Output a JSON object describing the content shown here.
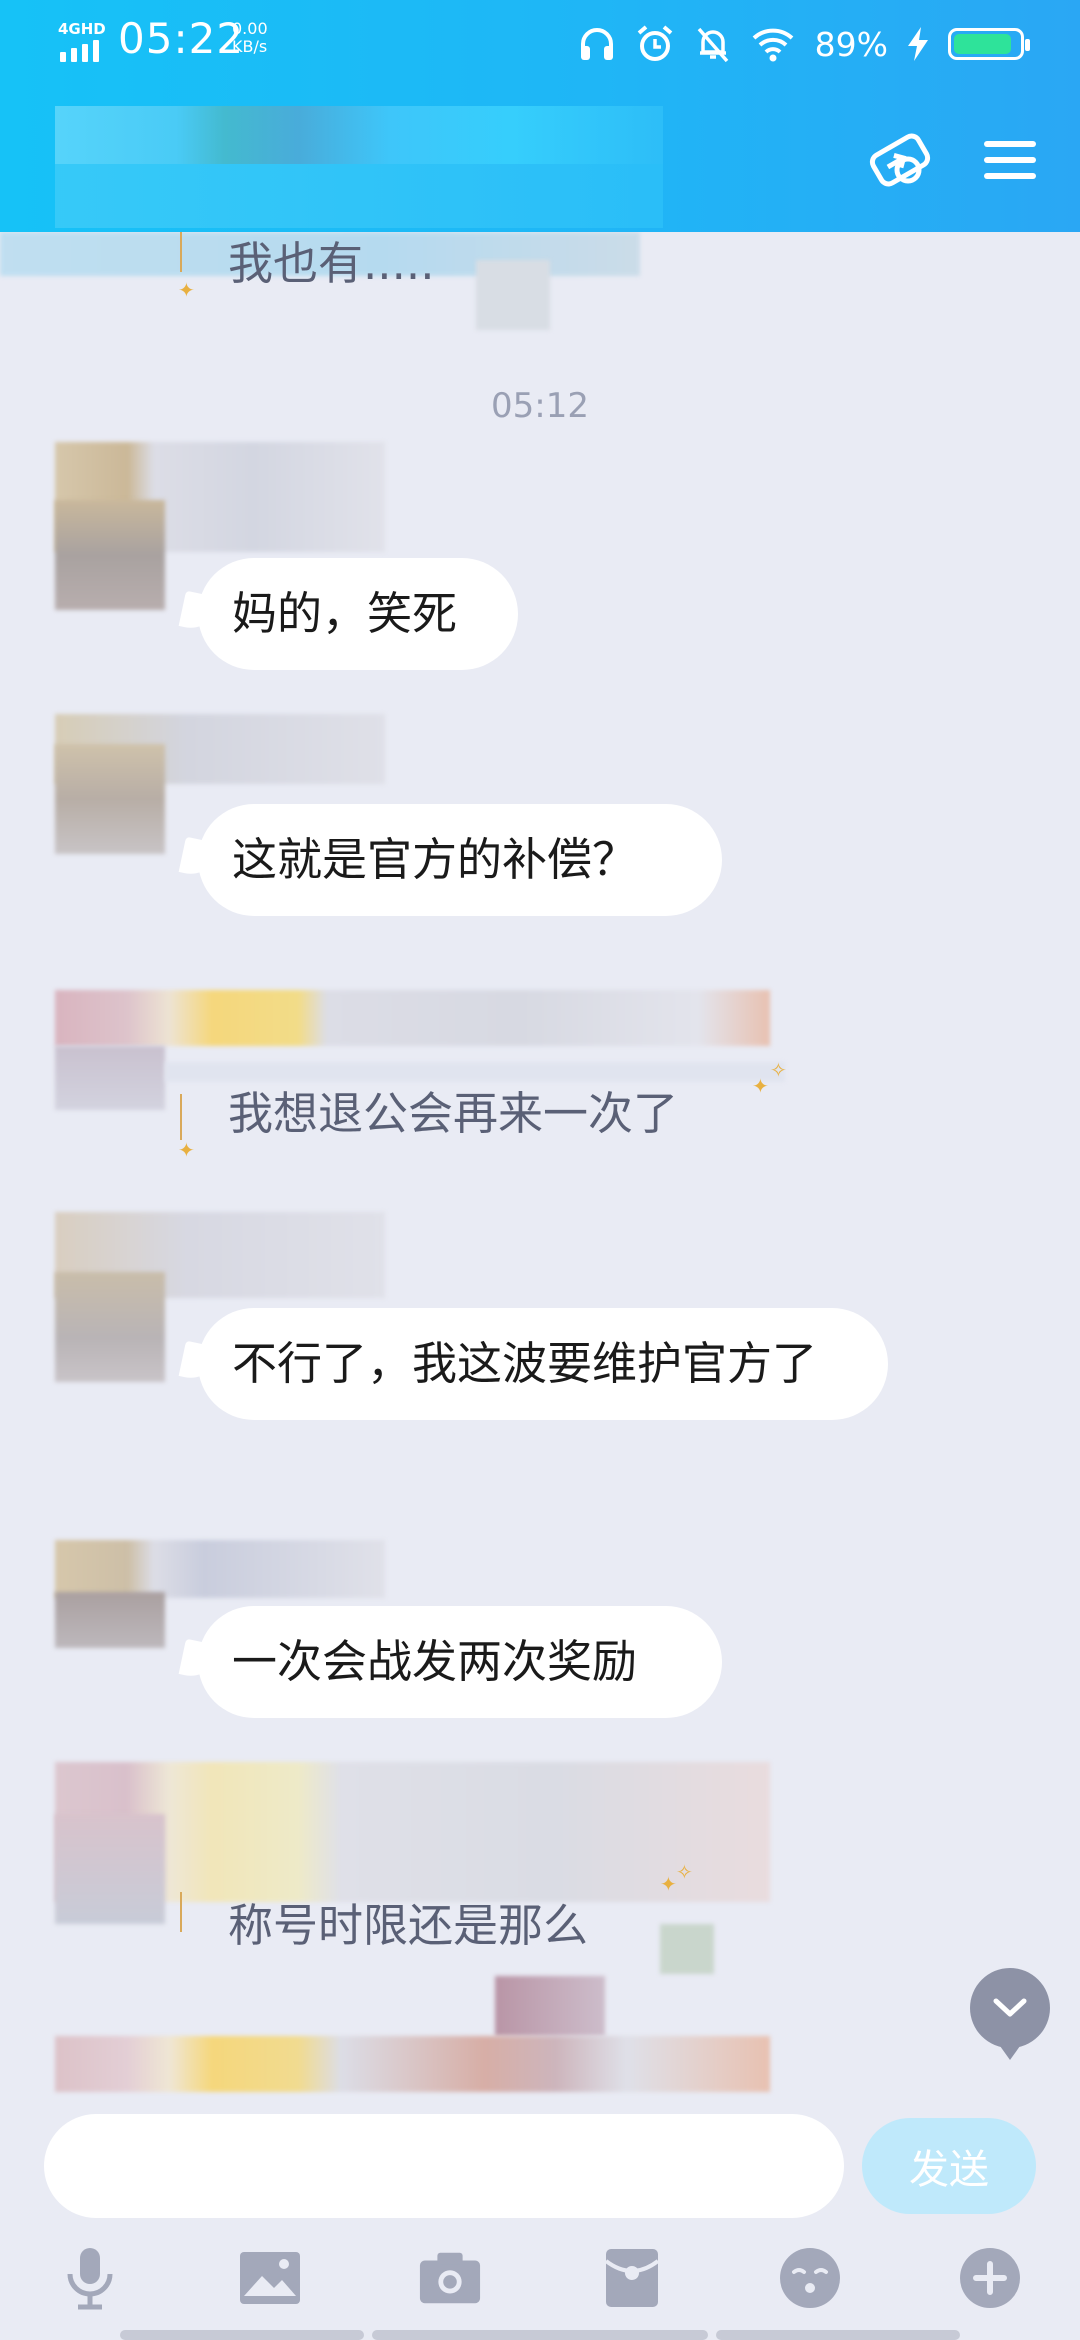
{
  "status_bar": {
    "network": "4GHD",
    "time": "05:22",
    "speed_value": "0.00",
    "speed_unit": "KB/s",
    "battery": "89%",
    "battery_level": 0.89,
    "battery_color": "#2ee39a"
  },
  "header": {
    "background": "#1fb6f6",
    "friend_icon": "add-friend-icon",
    "menu_icon": "menu-icon"
  },
  "messages": [
    {
      "kind": "decorated",
      "text": "我也有....."
    },
    {
      "kind": "time",
      "text": "05:12"
    },
    {
      "kind": "bubble",
      "text": "妈的，笑死"
    },
    {
      "kind": "bubble",
      "text": "这就是官方的补偿？"
    },
    {
      "kind": "decorated",
      "text": "我想退公会再来一次了"
    },
    {
      "kind": "bubble",
      "text": "不行了，我这波要维护官方了"
    },
    {
      "kind": "bubble",
      "text": "一次会战发两次奖励"
    },
    {
      "kind": "decorated",
      "text": "称号时限还是那么"
    }
  ],
  "composer": {
    "send_label": "发送",
    "send_color": "#bfe9fb"
  },
  "toolbar_icons": [
    "microphone-icon",
    "image-icon",
    "camera-icon",
    "red-packet-icon",
    "emoji-icon",
    "plus-icon"
  ]
}
